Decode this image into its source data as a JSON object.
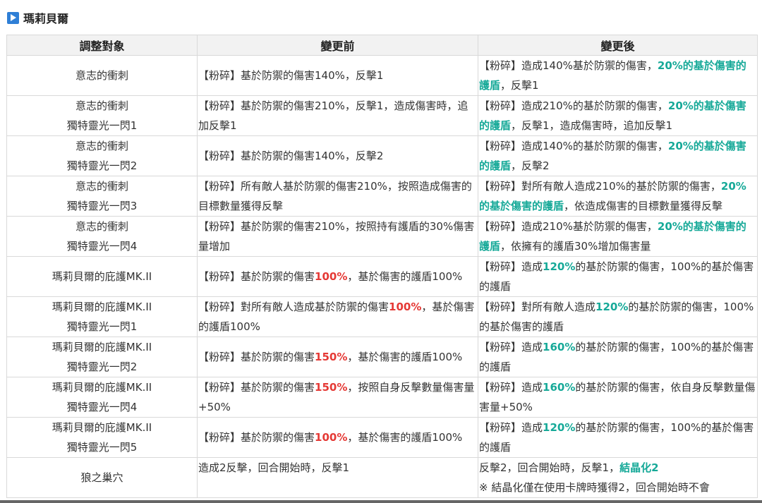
{
  "section": {
    "title": "瑪莉貝爾",
    "icon": "play-icon"
  },
  "table": {
    "headers": [
      "調整對象",
      "變更前",
      "變更後"
    ],
    "rows": [
      {
        "target": [
          "意志的衝刺"
        ],
        "before": [
          {
            "t": "【粉碎】基於防禦的傷害140%，反擊1"
          }
        ],
        "after": [
          {
            "t": "【粉碎】造成140%基於防禦的傷害，"
          },
          {
            "t": "20%的基於傷害的護盾",
            "s": "green"
          },
          {
            "t": "，反擊1"
          }
        ]
      },
      {
        "target": [
          "意志的衝刺",
          "獨特靈光一閃1"
        ],
        "before": [
          {
            "t": "【粉碎】基於防禦的傷害210%，反擊1，造成傷害時，追加反擊1"
          }
        ],
        "after": [
          {
            "t": "【粉碎】造成210%的基於防禦的傷害，"
          },
          {
            "t": "20%的基於傷害的護盾",
            "s": "green"
          },
          {
            "t": "，反擊1，造成傷害時，追加反擊1"
          }
        ]
      },
      {
        "target": [
          "意志的衝刺",
          "獨特靈光一閃2"
        ],
        "before": [
          {
            "t": "【粉碎】基於防禦的傷害140%，反擊2"
          }
        ],
        "after": [
          {
            "t": "【粉碎】造成140%的基於防禦的傷害，"
          },
          {
            "t": "20%的基於傷害的護盾",
            "s": "green"
          },
          {
            "t": "，反擊2"
          }
        ]
      },
      {
        "target": [
          "意志的衝刺",
          "獨特靈光一閃3"
        ],
        "before": [
          {
            "t": "【粉碎】所有敵人基於防禦的傷害210%，按照造成傷害的目標數量獲得反擊"
          }
        ],
        "after": [
          {
            "t": "【粉碎】對所有敵人造成210%的基於防禦的傷害，"
          },
          {
            "t": "20%的基於傷害的護盾",
            "s": "green"
          },
          {
            "t": "，依造成傷害的目標數量獲得反擊"
          }
        ]
      },
      {
        "target": [
          "意志的衝刺",
          "獨特靈光一閃4"
        ],
        "before": [
          {
            "t": "【粉碎】基於防禦的傷害210%，按照持有護盾的30%傷害量增加"
          }
        ],
        "after": [
          {
            "t": "【粉碎】造成210%基於防禦的傷害，"
          },
          {
            "t": "20%的基於傷害的護盾",
            "s": "green"
          },
          {
            "t": "，依擁有的護盾30%增加傷害量"
          }
        ]
      },
      {
        "target": [
          "瑪莉貝爾的庇護MK.II"
        ],
        "before": [
          {
            "t": "【粉碎】基於防禦的傷害"
          },
          {
            "t": "100%",
            "s": "red"
          },
          {
            "t": "，基於傷害的護盾100%"
          }
        ],
        "after": [
          {
            "t": "【粉碎】造成"
          },
          {
            "t": "120%",
            "s": "green"
          },
          {
            "t": "的基於防禦的傷害，100%的基於傷害的護盾"
          }
        ]
      },
      {
        "target": [
          "瑪莉貝爾的庇護MK.II",
          "獨特靈光一閃1"
        ],
        "before": [
          {
            "t": "【粉碎】對所有敵人造成基於防禦的傷害"
          },
          {
            "t": "100%",
            "s": "red"
          },
          {
            "t": "，基於傷害的護盾100%"
          }
        ],
        "after": [
          {
            "t": "【粉碎】對所有敵人造成"
          },
          {
            "t": "120%",
            "s": "green"
          },
          {
            "t": "的基於防禦的傷害，100%的基於傷害的護盾"
          }
        ]
      },
      {
        "target": [
          "瑪莉貝爾的庇護MK.II",
          "獨特靈光一閃2"
        ],
        "before": [
          {
            "t": "【粉碎】基於防禦的傷害"
          },
          {
            "t": "150%",
            "s": "red"
          },
          {
            "t": "，基於傷害的護盾100%"
          }
        ],
        "after": [
          {
            "t": "【粉碎】造成"
          },
          {
            "t": "160%",
            "s": "green"
          },
          {
            "t": "的基於防禦的傷害，100%的基於傷害的護盾"
          }
        ]
      },
      {
        "target": [
          "瑪莉貝爾的庇護MK.II",
          "獨特靈光一閃4"
        ],
        "before": [
          {
            "t": "【粉碎】基於防禦的傷害"
          },
          {
            "t": "150%",
            "s": "red"
          },
          {
            "t": "，按照自身反擊數量傷害量+50%"
          }
        ],
        "after": [
          {
            "t": "【粉碎】造成"
          },
          {
            "t": "160%",
            "s": "green"
          },
          {
            "t": "的基於防禦的傷害，依自身反擊數量傷害量+50%"
          }
        ]
      },
      {
        "target": [
          "瑪莉貝爾的庇護MK.II",
          "獨特靈光一閃5"
        ],
        "before": [
          {
            "t": "【粉碎】基於防禦的傷害"
          },
          {
            "t": "100%",
            "s": "red"
          },
          {
            "t": "，基於傷害的護盾100%"
          }
        ],
        "after": [
          {
            "t": "【粉碎】造成"
          },
          {
            "t": "120%",
            "s": "green"
          },
          {
            "t": "的基於防禦的傷害，100%的基於傷害的護盾"
          }
        ]
      },
      {
        "target": [
          "狼之巢穴"
        ],
        "before": [
          {
            "t": "造成2反擊，回合開始時，反擊1"
          }
        ],
        "after": [
          {
            "t": "反擊2，回合開始時，反擊1，"
          },
          {
            "t": "結晶化2",
            "s": "green"
          },
          {
            "t": "※ 結晶化僅在使用卡牌時獲得2，回合開始時不會",
            "s": "note"
          }
        ]
      }
    ]
  },
  "colors": {
    "increase": "#16a998",
    "old_value": "#e53935",
    "header_bg": "#f2f2f2",
    "border": "#d9d9d9"
  }
}
